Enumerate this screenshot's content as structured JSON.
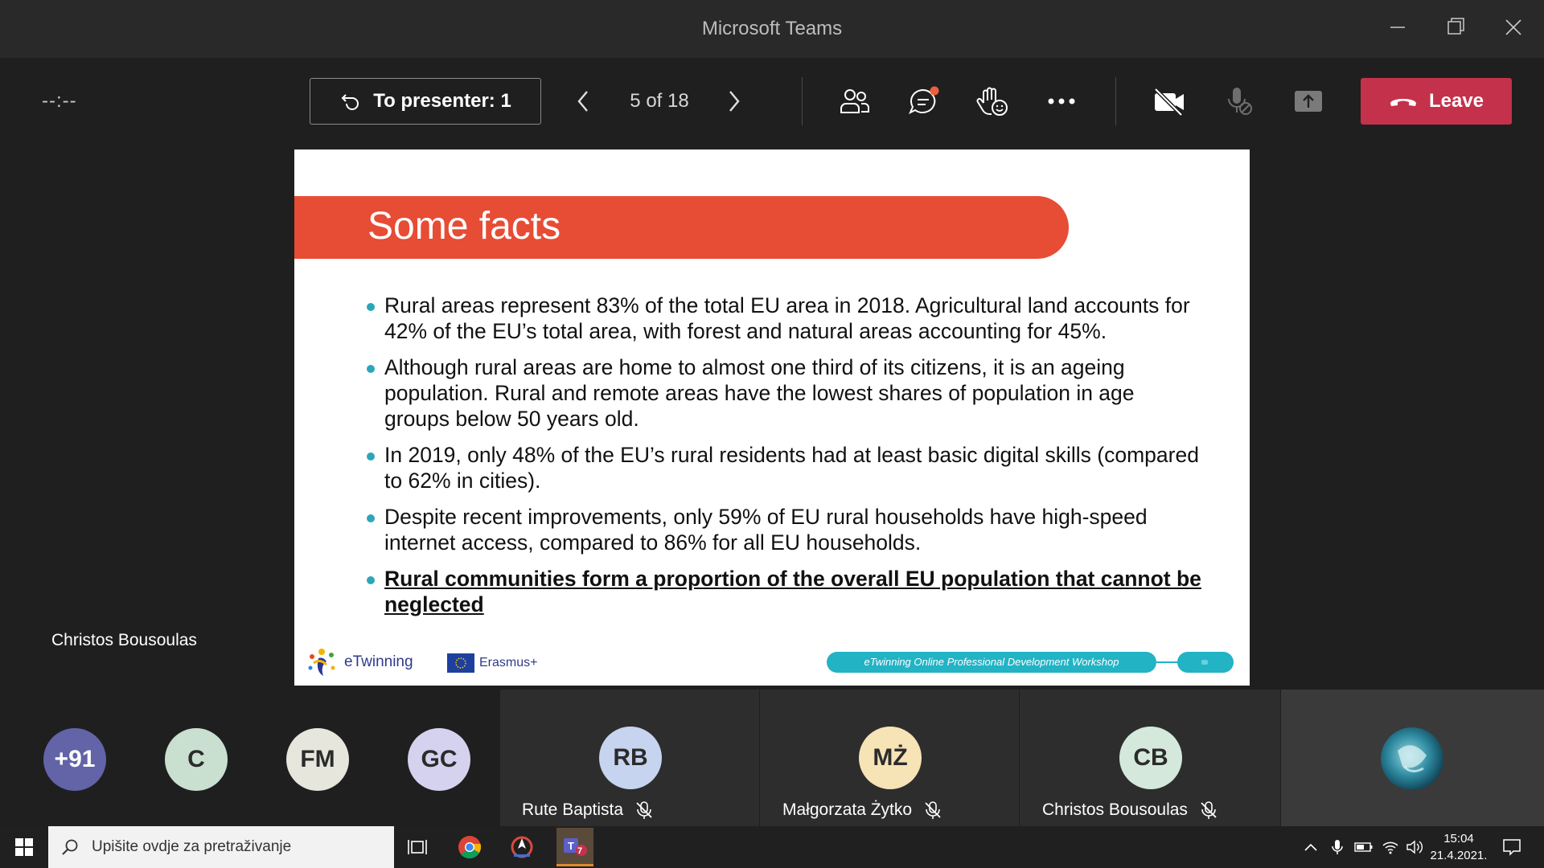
{
  "window": {
    "title": "Microsoft Teams"
  },
  "toolbar": {
    "timer": "--:--",
    "to_presenter_label": "To presenter: 1",
    "page_indicator": "5 of 18",
    "leave_label": "Leave"
  },
  "presenter": {
    "name": "Christos Bousoulas"
  },
  "slide": {
    "title": "Some facts",
    "bullets": [
      "Rural areas represent 83% of the total EU area in 2018. Agricultural land accounts for 42% of the EU’s total area, with forest and natural areas accounting for 45%.",
      "Although rural areas are home to almost one third of its citizens, it is an ageing population. Rural and remote areas have the lowest shares of population in age groups below 50 years old.",
      "In 2019, only 48% of the EU’s rural residents had at least basic digital skills (compared to 62% in cities).",
      "Despite recent improvements, only 59% of EU rural households have high-speed internet access, compared to 86% for all EU households.",
      "Rural communities form a proportion of the overall EU population that cannot be neglected"
    ],
    "logo_etwinning": "eTwinning",
    "logo_erasmus": "Erasmus+",
    "footer_pill": "eTwinning Online Professional Development Workshop",
    "colors": {
      "banner": "#e74c35",
      "bullet": "#2aa7b8",
      "pill": "#22b3c5"
    }
  },
  "participants": {
    "overflow": "+91",
    "avatars": [
      {
        "initials": "C",
        "color": "#c9dfd0"
      },
      {
        "initials": "FM",
        "color": "#e6e6dc"
      },
      {
        "initials": "GC",
        "color": "#d4d2ef"
      }
    ],
    "tiles": [
      {
        "initials": "RB",
        "name": "Rute Baptista",
        "color": "#c6d4f0"
      },
      {
        "initials": "MŻ",
        "name": "Małgorzata Żytko",
        "color": "#f6e3b6"
      },
      {
        "initials": "CB",
        "name": "Christos Bousoulas",
        "color": "#d4e8dc"
      }
    ]
  },
  "taskbar": {
    "search_placeholder": "Upišite ovdje za pretraživanje",
    "time": "15:04",
    "date": "21.4.2021.",
    "teams_badge": "7"
  },
  "colors": {
    "leave": "#c4314b",
    "overflow_avatar": "#6264a7"
  }
}
